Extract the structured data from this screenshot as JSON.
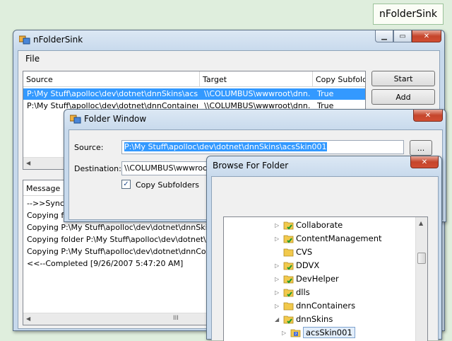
{
  "badge": {
    "label": "nFolderSink"
  },
  "main_window": {
    "title": "nFolderSink",
    "menu": {
      "file": "File"
    },
    "columns": [
      "Source",
      "Target",
      "Copy Subfolde"
    ],
    "rows": [
      {
        "source": "P:\\My Stuff\\apolloc\\dev\\dotnet\\dnnSkins\\acsS...",
        "target": "\\\\COLUMBUS\\wwwroot\\dnn...",
        "copy": "True"
      },
      {
        "source": "P:\\My Stuff\\apolloc\\dev\\dotnet\\dnnContainers\\...",
        "target": "\\\\COLUMBUS\\wwwroot\\dnn...",
        "copy": "True"
      }
    ],
    "buttons": {
      "start": "Start",
      "add": "Add"
    },
    "message_header": "Message",
    "messages": [
      "-->>Synchro",
      "Copying fold",
      "Copying P:\\My Stuff\\apolloc\\dev\\dotnet\\dnnSkins\\acs",
      "Copying folder P:\\My Stuff\\apolloc\\dev\\dotnet\\dnnCo",
      "Copying P:\\My Stuff\\apolloc\\dev\\dotnet\\dnnContaine",
      "<<--Completed [9/26/2007 5:47:20 AM]"
    ],
    "scroll_grip": "III"
  },
  "folder_window": {
    "title": "Folder Window",
    "source_label": "Source:",
    "source_value": "P:\\My Stuff\\apolloc\\dev\\dotnet\\dnnSkins\\acsSkin001",
    "browse_button": "...",
    "destination_label": "Destination:",
    "destination_value": "\\\\COLUMBUS\\wwwroot\\",
    "copy_subfolders_label": "Copy Subfolders",
    "copy_subfolders_checked": true
  },
  "browse_dialog": {
    "title": "Browse For Folder",
    "folders": [
      {
        "name": "Collaborate",
        "expandable": true,
        "check": true
      },
      {
        "name": "ContentManagement",
        "expandable": true,
        "check": true
      },
      {
        "name": "CVS",
        "expandable": false,
        "check": false
      },
      {
        "name": "DDVX",
        "expandable": true,
        "check": true
      },
      {
        "name": "DevHelper",
        "expandable": true,
        "check": true
      },
      {
        "name": "dlls",
        "expandable": true,
        "check": true
      },
      {
        "name": "dnnContainers",
        "expandable": true,
        "check": false
      },
      {
        "name": "dnnSkins",
        "expandable": true,
        "expanded": true,
        "check": true
      },
      {
        "name": "acsSkin001",
        "expandable": true,
        "check": false,
        "selected": true
      }
    ]
  },
  "icons": {
    "app": "app-window-icon",
    "minimize": "minimize-icon",
    "maximize": "maximize-icon",
    "close": "close-icon",
    "folder": "folder-icon",
    "check": "checkbox-check-icon",
    "expander": "tree-expander-icon"
  },
  "colors": {
    "selection": "#3399ff",
    "close_red": "#c5452c",
    "folder_yellow": "#f2c94c"
  }
}
